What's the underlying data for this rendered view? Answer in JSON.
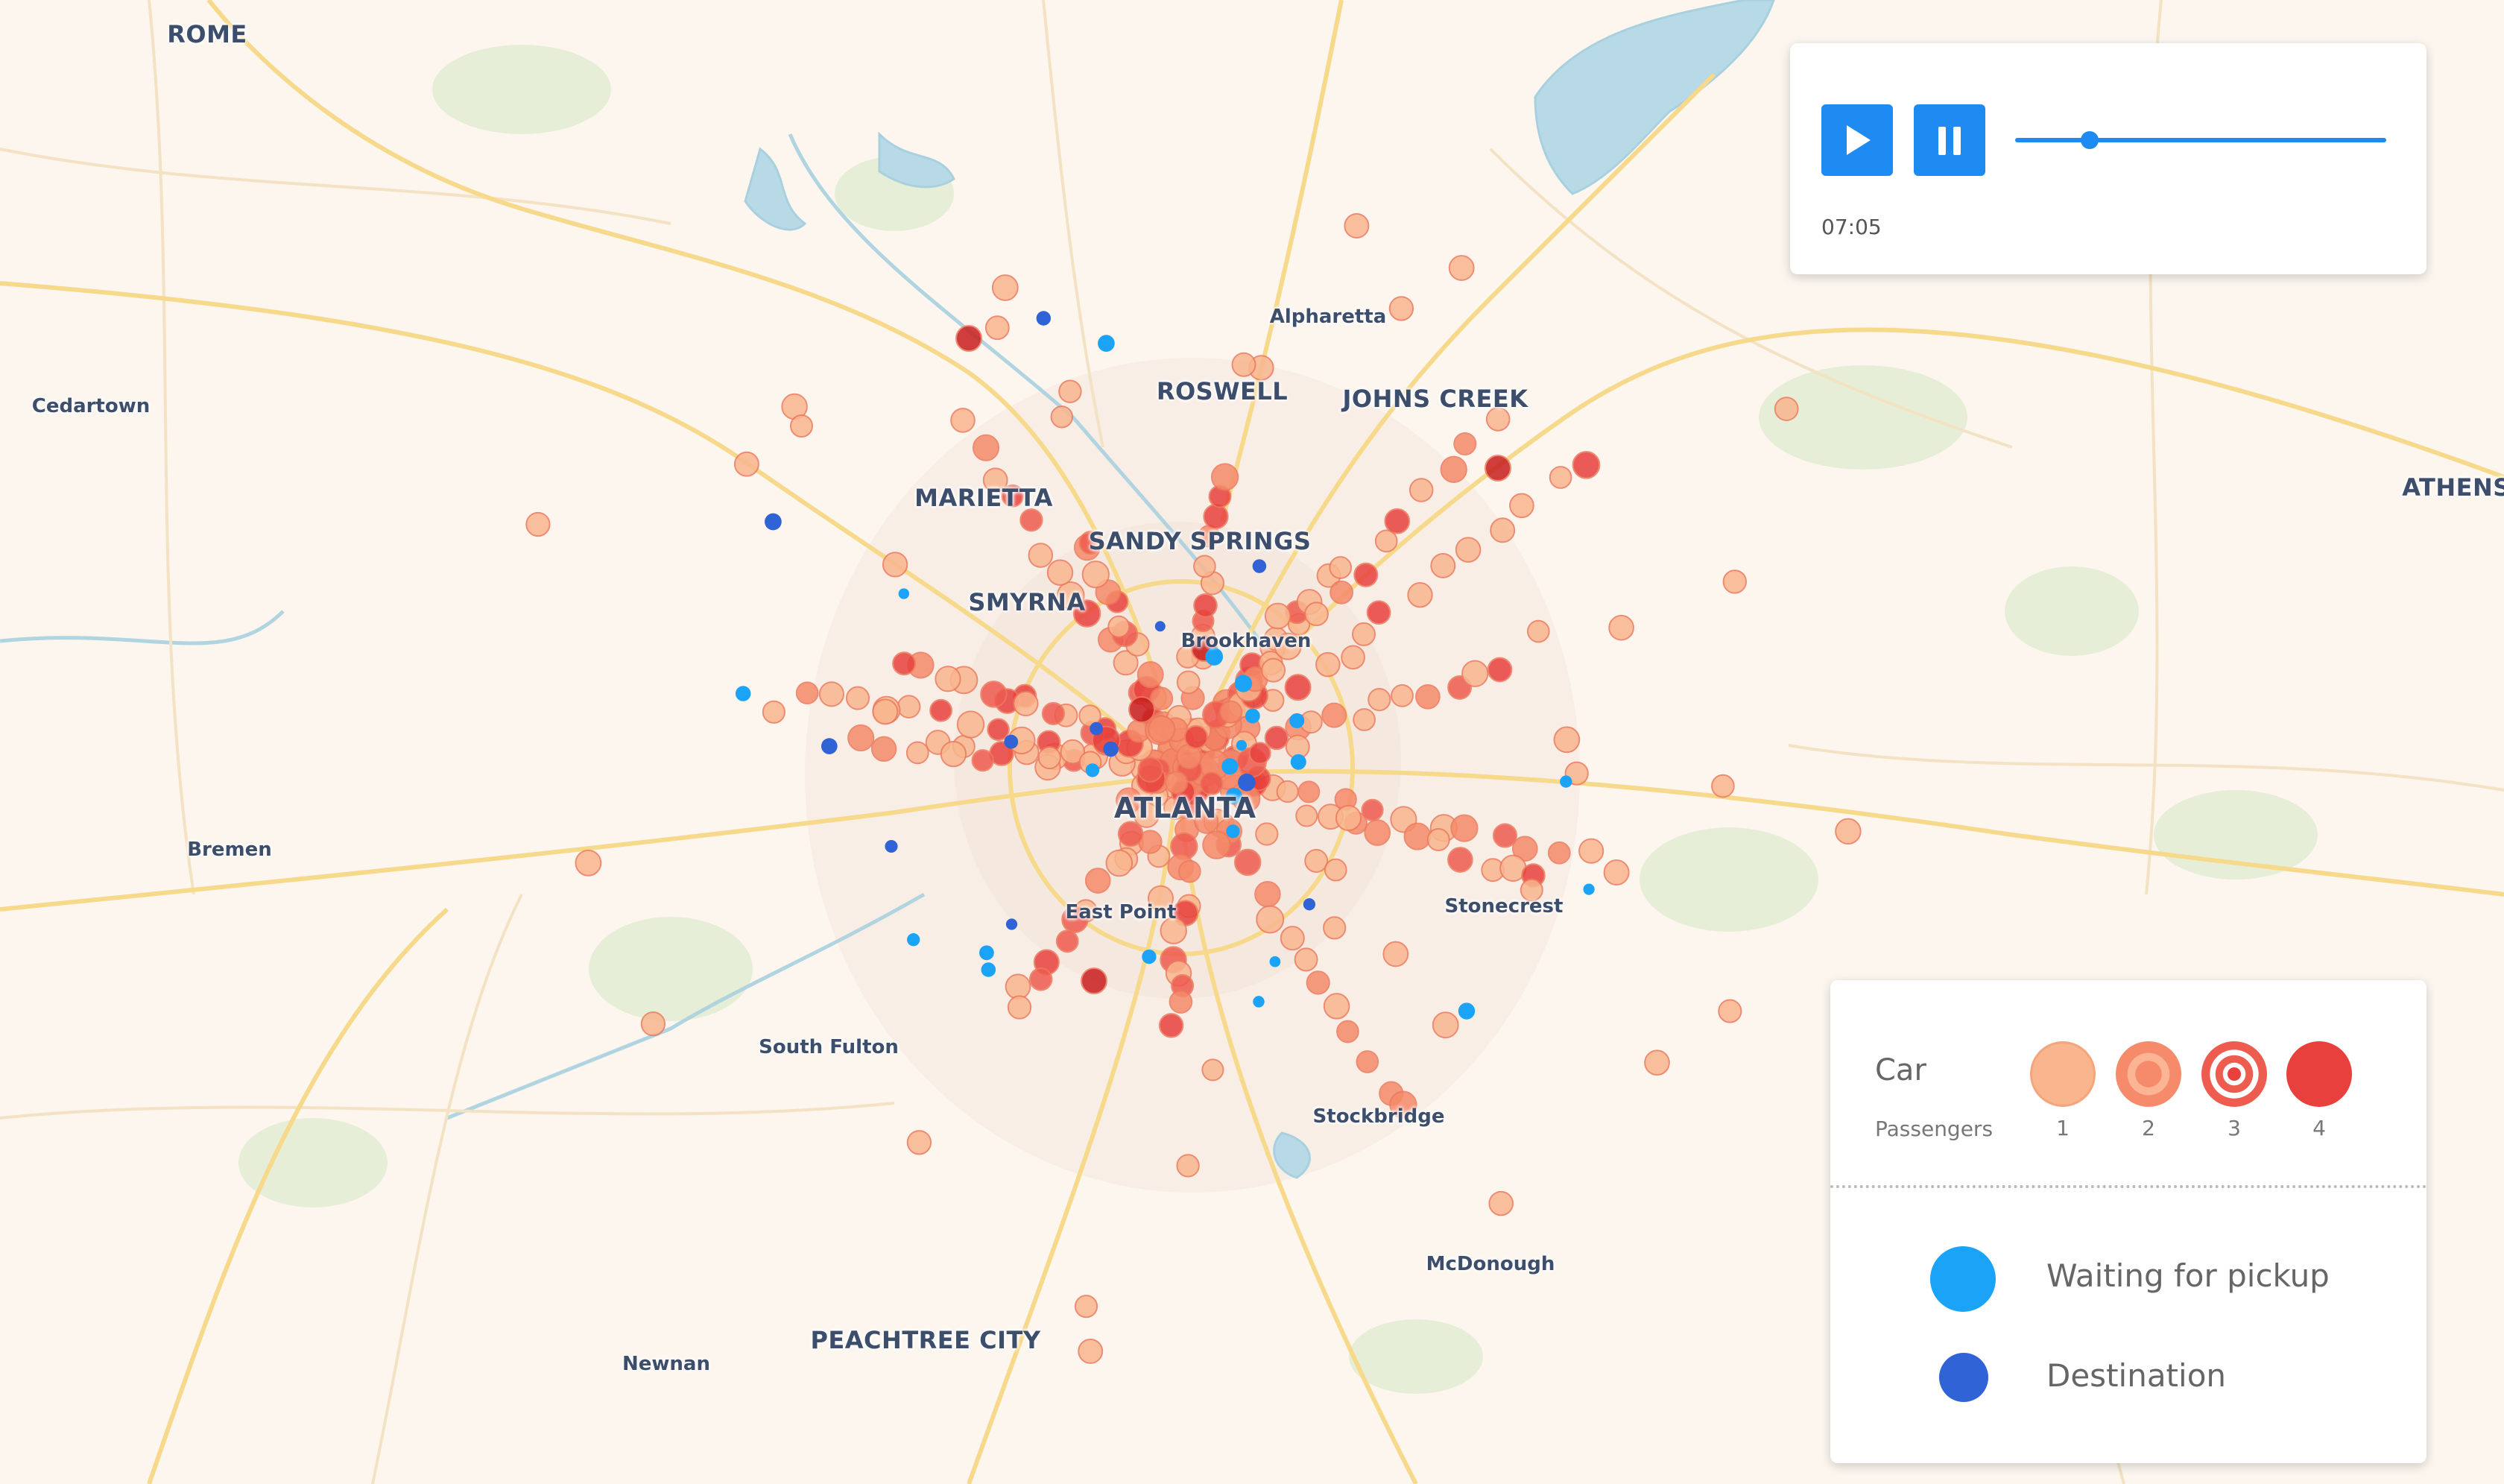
{
  "map": {
    "colors": {
      "land": "#fcf6ef",
      "water": "#b8dae6",
      "park": "#e3ecd4",
      "highway": "#f7d98c",
      "road": "#f3e2c4"
    },
    "cities": [
      {
        "name": "ROME",
        "style": "major"
      },
      {
        "name": "Cedartown",
        "style": "minor"
      },
      {
        "name": "Alpharetta",
        "style": "minor"
      },
      {
        "name": "ROSWELL",
        "style": "major"
      },
      {
        "name": "JOHNS CREEK",
        "style": "major"
      },
      {
        "name": "MARIETTA",
        "style": "major"
      },
      {
        "name": "SANDY SPRINGS",
        "style": "major"
      },
      {
        "name": "SMYRNA",
        "style": "major"
      },
      {
        "name": "Brookhaven",
        "style": "minor"
      },
      {
        "name": "ATLANTA",
        "style": "big"
      },
      {
        "name": "ATHENS",
        "style": "major"
      },
      {
        "name": "Bremen",
        "style": "minor"
      },
      {
        "name": "East Point",
        "style": "minor"
      },
      {
        "name": "Stonecrest",
        "style": "minor"
      },
      {
        "name": "South Fulton",
        "style": "minor"
      },
      {
        "name": "Stockbridge",
        "style": "minor"
      },
      {
        "name": "McDonough",
        "style": "minor"
      },
      {
        "name": "PEACHTREE CITY",
        "style": "major"
      },
      {
        "name": "Newnan",
        "style": "minor"
      }
    ]
  },
  "playback": {
    "play_icon": "play-icon",
    "pause_icon": "pause-icon",
    "progress": 0.2,
    "time": "07:05",
    "accent": "#1d8bf1"
  },
  "legend": {
    "car_label": "Car",
    "passengers_label": "Passengers",
    "passenger_counts": [
      {
        "count": "1",
        "color": "#f9b68e"
      },
      {
        "count": "2",
        "color": "#f58b6a"
      },
      {
        "count": "3",
        "color": "#ee5b4f"
      },
      {
        "count": "4",
        "color": "#e8413d"
      }
    ],
    "waiting_label": "Waiting for pickup",
    "waiting_color": "#1aa3f7",
    "destination_label": "Destination",
    "destination_color": "#2f63d6"
  }
}
